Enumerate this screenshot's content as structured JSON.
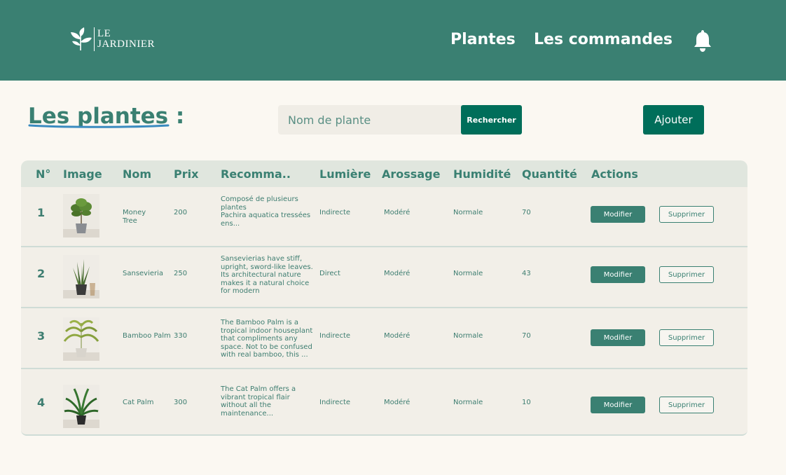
{
  "header": {
    "logo_line1": "LE",
    "logo_line2": "JARDINIER",
    "nav": [
      "Plantes",
      "Les commandes"
    ],
    "icon": "bell-icon"
  },
  "page": {
    "title": "Les plantes :",
    "search_placeholder": "Nom de plante",
    "search_button": "Rechercher",
    "add_button": "Ajouter"
  },
  "table": {
    "columns": [
      "N°",
      "Image",
      "Nom",
      "Prix",
      "Recomma..",
      "Lumière",
      "Arossage",
      "Humidité",
      "Quantité",
      "Actions"
    ],
    "rows": [
      {
        "num": "1",
        "nom": "Money\nTree",
        "prix": "200",
        "reco": "Composé de plusieurs\nplantes\nPachira aquatica tressées\nens...",
        "lumiere": "Indirecte",
        "arrosage": "Modéré",
        "humidite": "Normale",
        "quantite": "70",
        "modifier": "Modifier",
        "supprimer": "Supprimer",
        "image": "money-tree-plant-image"
      },
      {
        "num": "2",
        "nom": "Sansevieria",
        "prix": "250",
        "reco": "Sansevierias have stiff,\nupright, sword-like leaves.\nIts architectural nature\nmakes it a natural choice\nfor modern",
        "lumiere": "Direct",
        "arrosage": "Modéré",
        "humidite": "Normale",
        "quantite": "43",
        "modifier": "Modifier",
        "supprimer": "Supprimer",
        "image": "sansevieria-plant-image"
      },
      {
        "num": "3",
        "nom": "Bamboo Palm",
        "prix": "330",
        "reco": "The Bamboo Palm is a\ntropical indoor houseplant\nthat compliments any\nspace. Not to be confused\nwith real bamboo, this ...",
        "lumiere": "Indirecte",
        "arrosage": "Modéré",
        "humidite": "Normale",
        "quantite": "70",
        "modifier": "Modifier",
        "supprimer": "Supprimer",
        "image": "bamboo-palm-plant-image"
      },
      {
        "num": "4",
        "nom": "Cat Palm",
        "prix": "300",
        "reco": "The Cat Palm offers a\nvibrant tropical flair\nwithout all the\nmaintenance...",
        "lumiere": "Indirecte",
        "arrosage": "Modéré",
        "humidite": "Normale",
        "quantite": "10",
        "modifier": "Modifier",
        "supprimer": "Supprimer",
        "image": "cat-palm-plant-image"
      }
    ]
  },
  "colors": {
    "primary": "#3a8072",
    "dark_button": "#006e5a",
    "background": "#fbf8f2"
  }
}
